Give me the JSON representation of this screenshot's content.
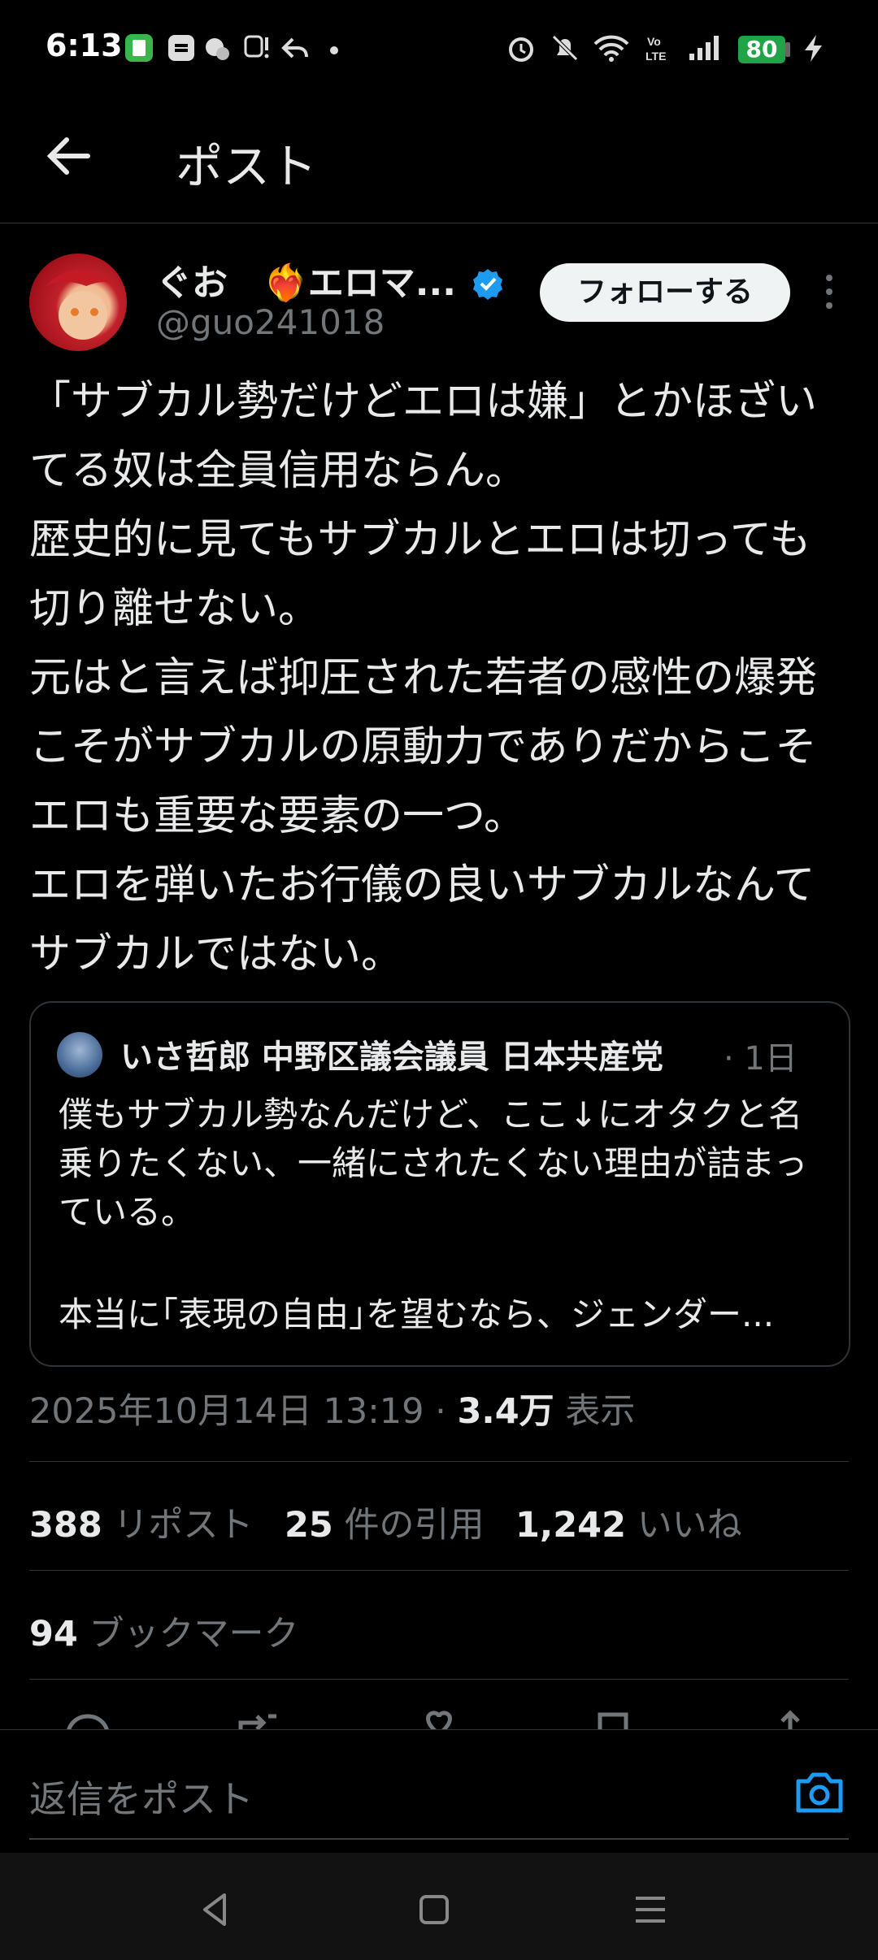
{
  "status_bar": {
    "time": "6:13",
    "battery": "80",
    "left_icons": [
      "app-icon",
      "sync-icon",
      "weather-icon",
      "transit-icon",
      "reply-arrow-icon",
      "dot-icon"
    ],
    "right_icons": [
      "alarm-icon",
      "mute-icon",
      "wifi-icon",
      "volte-icon",
      "signal-icon",
      "charging-icon"
    ]
  },
  "header": {
    "title": "ポスト"
  },
  "post": {
    "author_name": "ぐお　❤️‍🔥エロマ...",
    "verified": true,
    "handle": "@guo241018",
    "follow_label": "フォローする",
    "text": "「サブカル勢だけどエロは嫌」とかほざいてる奴は全員信用ならん。\n歴史的に見てもサブカルとエロは切っても切り離せない。\n元はと言えば抑圧された若者の感性の爆発こそがサブカルの原動力でありだからこそエロも重要な要素の一つ。\nエロを弾いたお行儀の良いサブカルなんてサブカルではない。",
    "quote": {
      "author": "いさ哲郎 中野区議会議員 日本共産党",
      "time": "· 1日",
      "text": "僕もサブカル勢なんだけど、ここ↓にオタクと名乗りたくない、一緒にされたくない理由が詰まっている。",
      "text2": "本当に｢表現の自由｣を望むなら、ジェンダー..."
    },
    "meta": {
      "datetime": "2025年10月14日 13:19 · ",
      "views": "3.4万",
      "views_label": " 表示"
    },
    "stats": {
      "reposts": "388",
      "reposts_label": "リポスト",
      "quotes": "25",
      "quotes_label": "件の引用",
      "likes": "1,242",
      "likes_label": "いいね",
      "bookmarks": "94",
      "bookmarks_label": "ブックマーク"
    }
  },
  "reply": {
    "placeholder": "返信をポスト"
  },
  "colors": {
    "accent": "#1d9bf0",
    "background": "#000000",
    "muted": "#71767b",
    "battery": "#1ea547"
  }
}
